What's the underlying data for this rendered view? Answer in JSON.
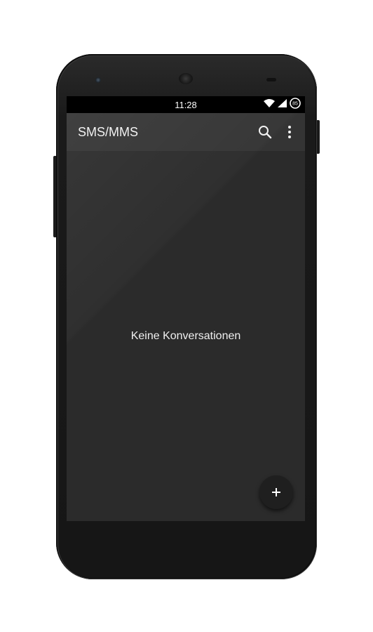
{
  "status_bar": {
    "time": "11:28",
    "battery_level": "85",
    "icons": [
      "wifi-icon",
      "signal-icon",
      "battery-icon"
    ]
  },
  "app_bar": {
    "title": "SMS/MMS",
    "actions": [
      "search-icon",
      "more-vert-icon"
    ]
  },
  "main": {
    "empty_message": "Keine Konversationen"
  },
  "fab": {
    "icon": "plus-icon"
  },
  "colors": {
    "screen_background": "#2b2b2b",
    "app_bar": "#343434",
    "status_bar": "#000000",
    "fab": "#1f1f1f",
    "text": "#f0f0f0"
  }
}
